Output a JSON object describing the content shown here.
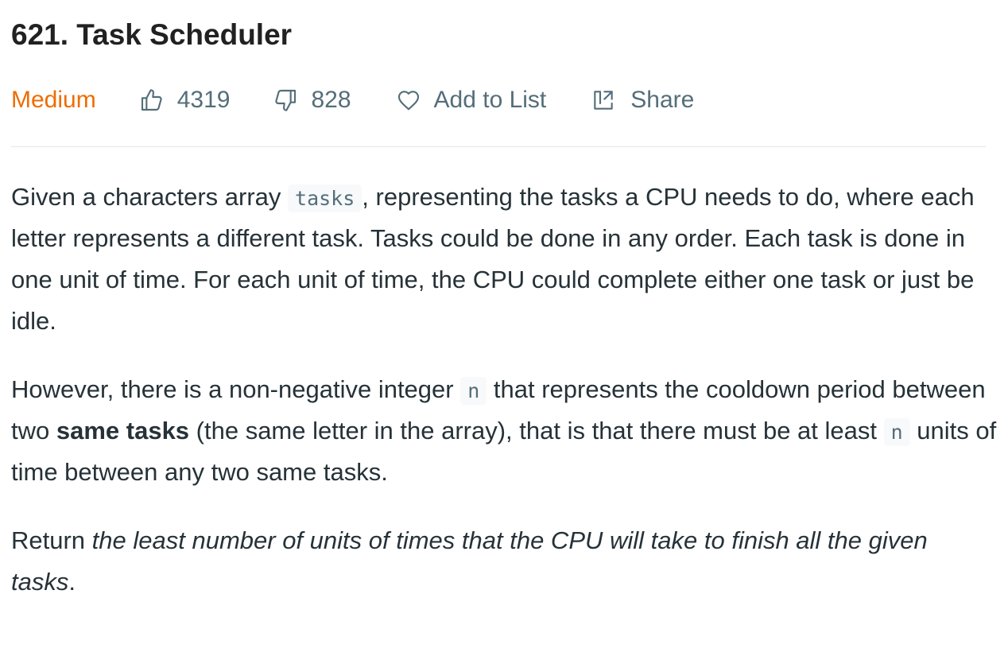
{
  "problem": {
    "title": "621. Task Scheduler",
    "difficulty": "Medium",
    "likes": "4319",
    "dislikes": "828",
    "add_to_list_label": "Add to List",
    "share_label": "Share"
  },
  "description": {
    "p1": {
      "text_before": "Given a characters array ",
      "code_tasks": "tasks",
      "text_after": ", representing the tasks a CPU needs to do, where each letter represents a different task. Tasks could be done in any order. Each task is done in one unit of time. For each unit of time, the CPU could complete either one task or just be idle."
    },
    "p2": {
      "text_before": "However, there is a non-negative integer ",
      "code_n": "n",
      "text_mid": " that represents the cooldown period between two ",
      "bold": "same tasks",
      "text_mid2": " (the same letter in the array), that is that there must be at least ",
      "code_n2": "n",
      "text_after": " units of time between any two same tasks."
    },
    "p3": {
      "text_before": "Return ",
      "italic": "the least number of units of times that the CPU will take to finish all the given tasks",
      "text_after": "."
    }
  },
  "colors": {
    "difficulty_medium": "#ef6c00",
    "meta_text": "#546e7a",
    "body_text": "#263238",
    "divider": "#e6e6e6",
    "code_bg": "#f7f9fa"
  },
  "icons": {
    "like": "thumbs-up-icon",
    "dislike": "thumbs-down-icon",
    "add_to_list": "heart-icon",
    "share": "share-icon"
  }
}
